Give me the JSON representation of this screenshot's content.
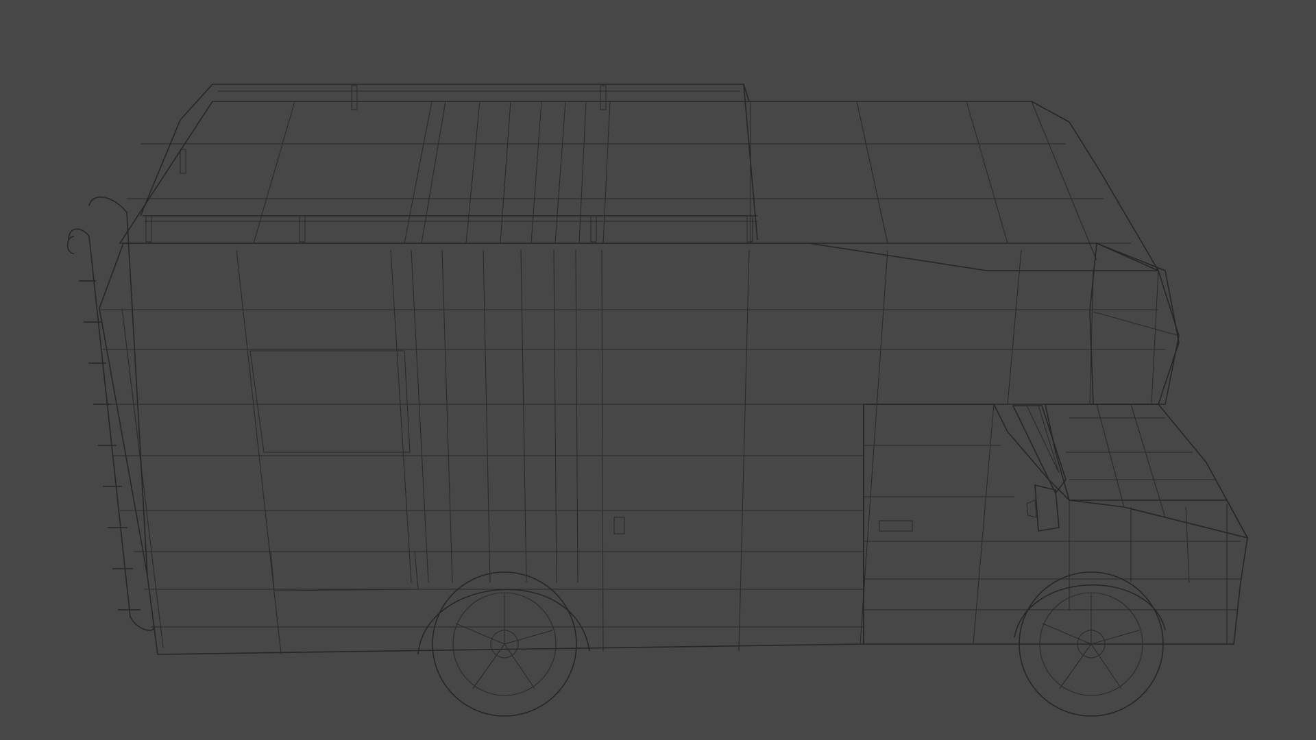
{
  "viewport": {
    "background_color": "#474747",
    "shading": "solid-gray-wireframe-overlay"
  },
  "model": {
    "object": "camper-van-rv",
    "view": "side-perspective",
    "body_color": "#8c8d8d",
    "roof_color": "#929393",
    "wire_color": "#2a2a2a",
    "glass_color": "#7a8a8a",
    "parts": [
      "roof-rack",
      "rear-ladder",
      "side-body-panels",
      "over-cab-alcove",
      "cab-hood",
      "side-mirror",
      "door-handles",
      "front-wheel",
      "rear-wheel"
    ]
  }
}
